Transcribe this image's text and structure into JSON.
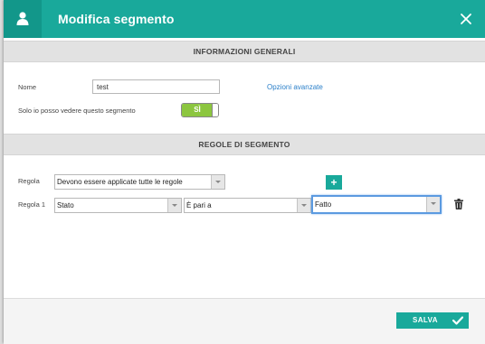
{
  "dialog": {
    "title": "Modifica segmento",
    "accent_color": "#19a99b",
    "header_icon": "user-icon",
    "close_icon": "close-icon"
  },
  "general": {
    "section_title": "INFORMAZIONI GENERALI",
    "name_label": "Nome",
    "name_value": "test",
    "advanced_link": "Opzioni avanzate",
    "private_label": "Solo io posso vedere questo segmento",
    "private_toggle_label": "SÌ",
    "private_toggle_on": true
  },
  "rules": {
    "section_title": "REGOLE DI SEGMENTO",
    "rule_label": "Regola",
    "rule_match_value": "Devono essere applicate tutte le regole",
    "add_icon": "plus-icon",
    "rule1_label": "Regola 1",
    "rule1_field": "Stato",
    "rule1_operator": "È pari a",
    "rule1_value": "Fatto",
    "delete_icon": "trash-icon"
  },
  "footer": {
    "save_label": "SALVA",
    "save_icon": "check-icon"
  }
}
